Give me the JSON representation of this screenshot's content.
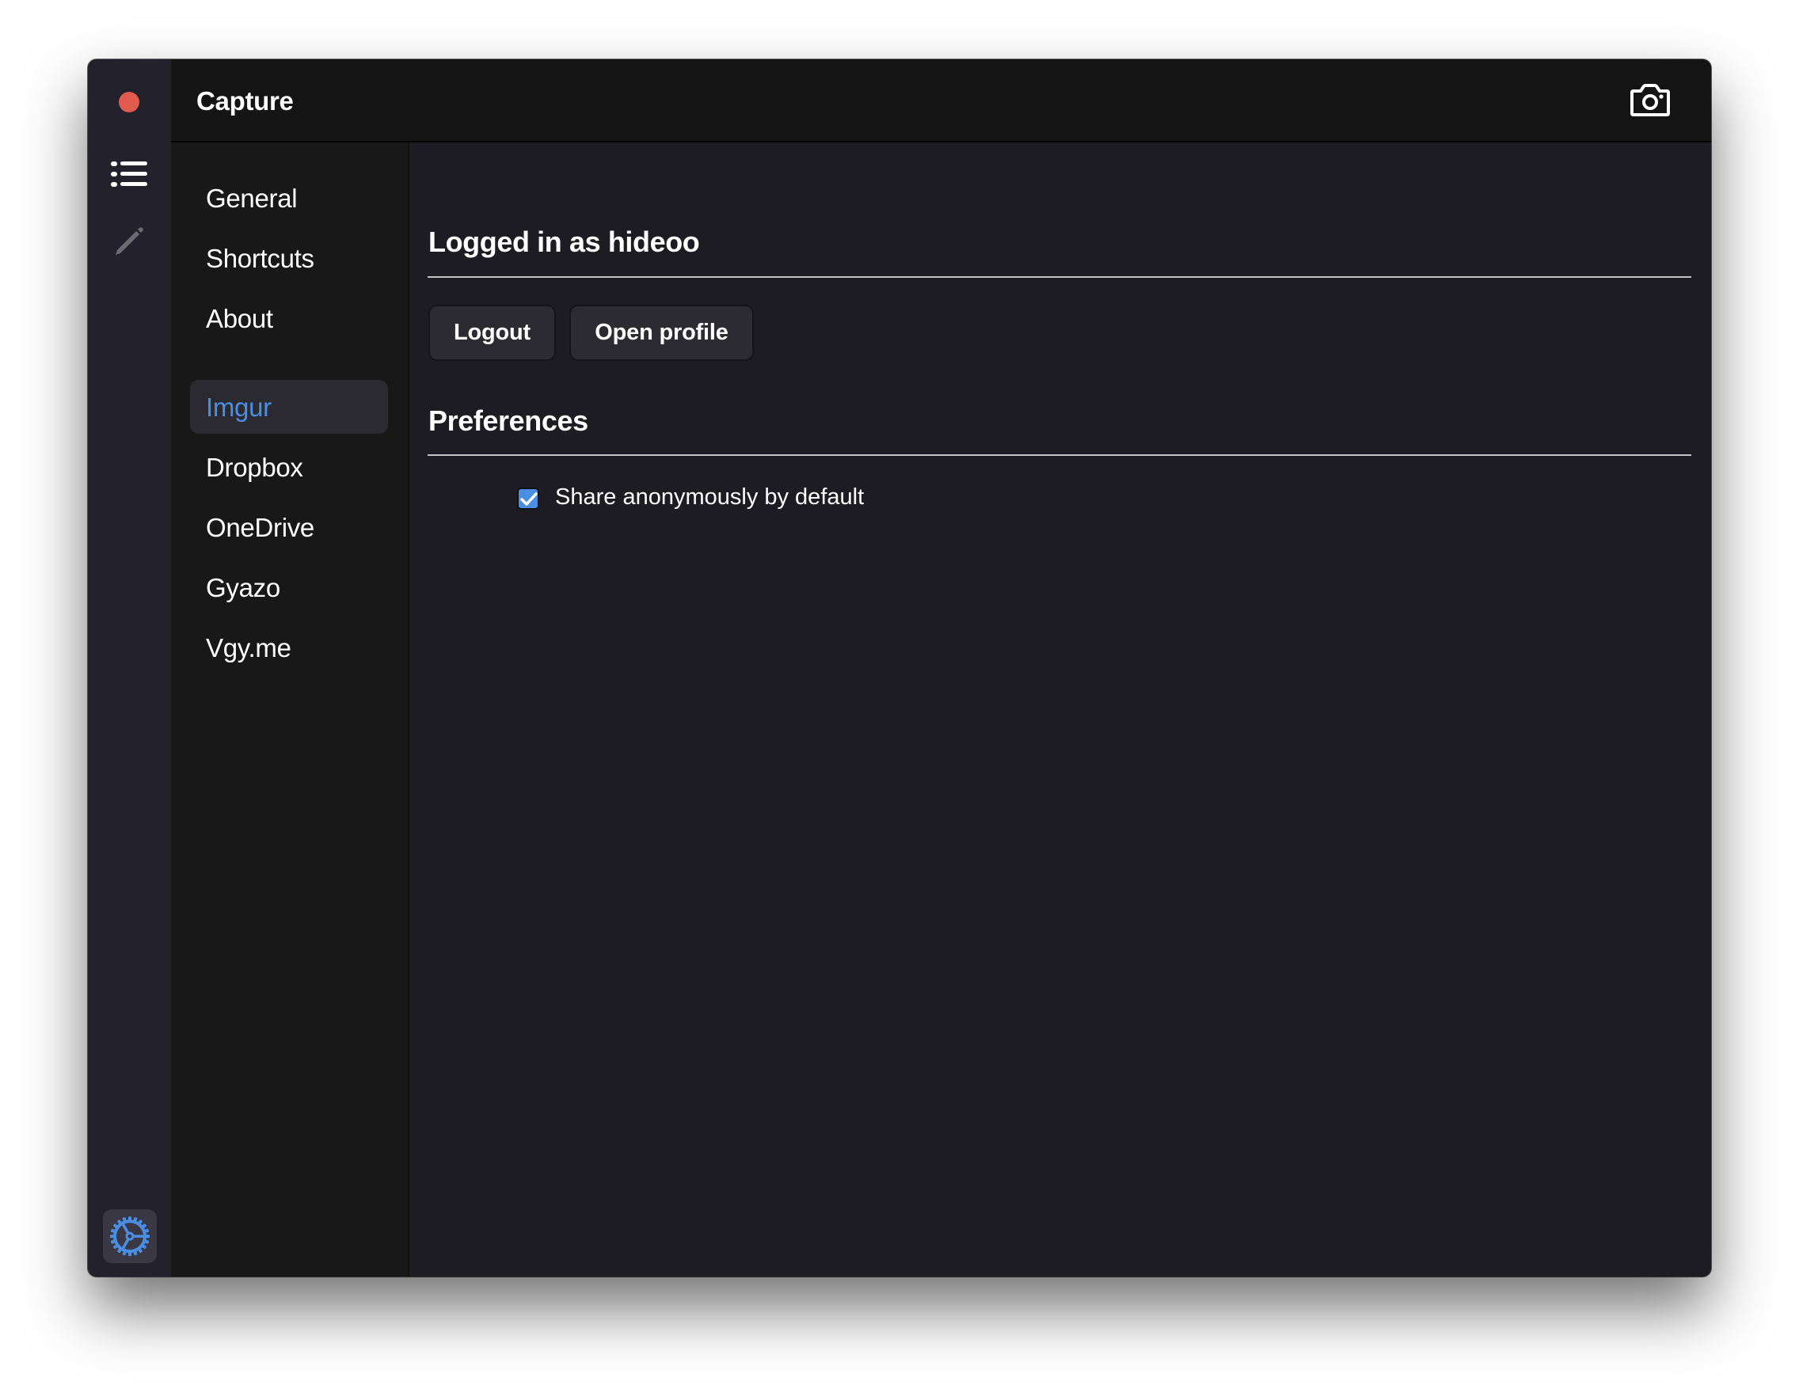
{
  "window": {
    "title": "Capture",
    "close_color": "#e05a4e",
    "accent_color": "#4a8ee3"
  },
  "icon_strip": {
    "items": [
      {
        "icon": "list-icon",
        "label": "History"
      },
      {
        "icon": "pencil-icon",
        "label": "Editor"
      }
    ],
    "settings_icon": "gear-icon"
  },
  "header": {
    "title": "Capture",
    "action_icon": "camera-icon"
  },
  "sidebar": {
    "general_items": [
      {
        "label": "General"
      },
      {
        "label": "Shortcuts"
      },
      {
        "label": "About"
      }
    ],
    "uploader_items": [
      {
        "label": "Imgur",
        "active": true
      },
      {
        "label": "Dropbox"
      },
      {
        "label": "OneDrive"
      },
      {
        "label": "Gyazo"
      },
      {
        "label": "Vgy.me"
      }
    ]
  },
  "content": {
    "account_title": "Logged in as hideoo",
    "buttons": {
      "logout": "Logout",
      "open_profile": "Open profile"
    },
    "preferences_title": "Preferences",
    "preferences": [
      {
        "label": "Share anonymously by default",
        "checked": true
      }
    ]
  }
}
